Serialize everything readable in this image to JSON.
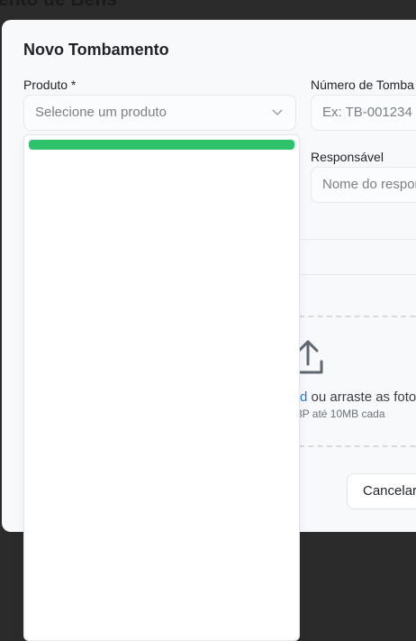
{
  "background": {
    "page_title": "ento de Bens"
  },
  "modal": {
    "title": "Novo Tombamento",
    "fields": {
      "produto": {
        "label": "Produto *",
        "placeholder": "Selecione um produto"
      },
      "numero": {
        "label": "Número de Tomba",
        "placeholder": "Ex: TB-001234"
      },
      "responsavel": {
        "label": "Responsável",
        "placeholder": "Nome do respor"
      }
    },
    "upload": {
      "icon": "upload-icon",
      "link_text": "d",
      "text": " ou arraste as fotos",
      "hint": "3P até 10MB cada"
    },
    "buttons": {
      "cancel": "Cancelar"
    }
  },
  "dropdown": {
    "progress_fraction": 1.0,
    "bar_color": "#2ec26a"
  },
  "colors": {
    "overlay": "#2b2b2b",
    "modal_bg": "#f8f9fb",
    "link": "#2b77c9",
    "accent_green": "#2ec26a"
  }
}
